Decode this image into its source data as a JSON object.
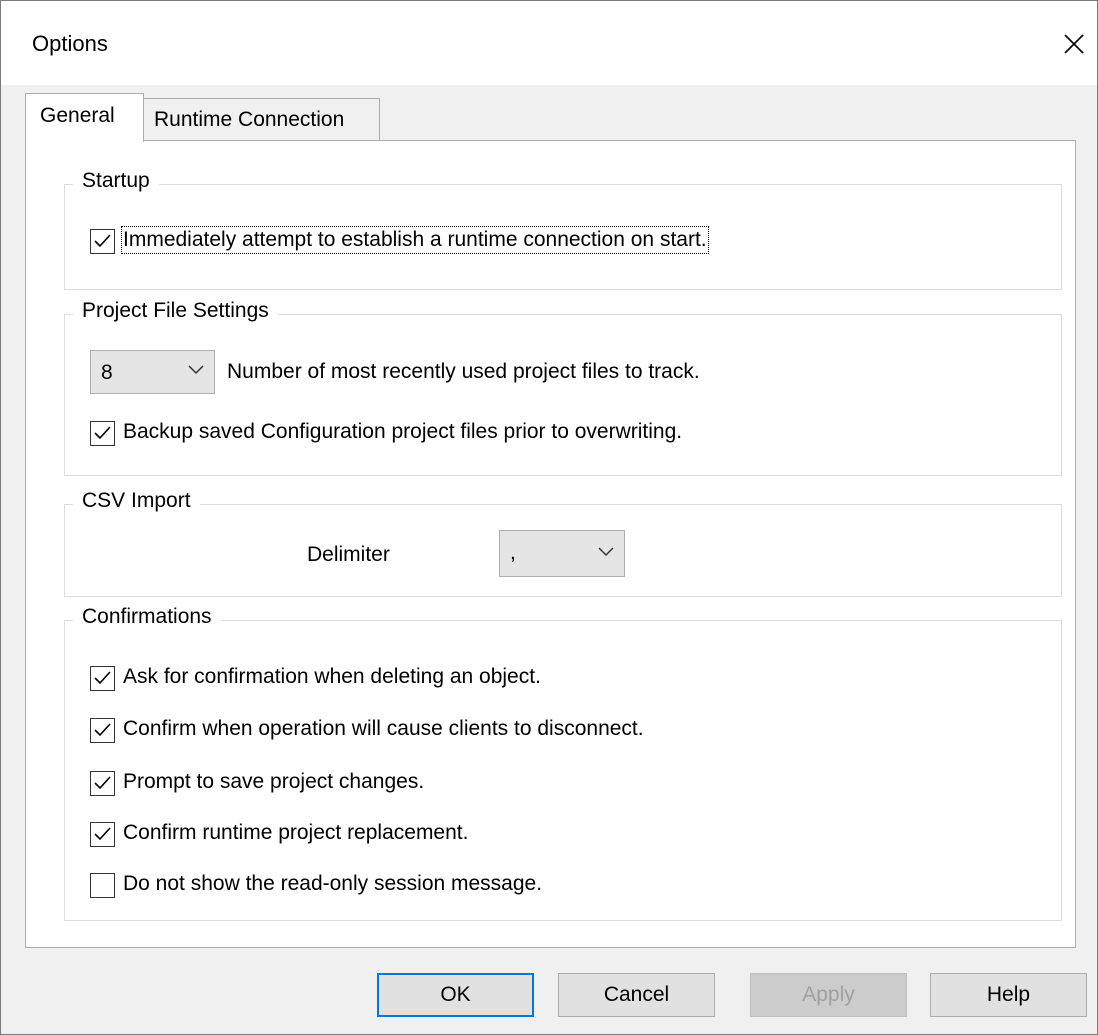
{
  "window": {
    "title": "Options"
  },
  "tabs": [
    {
      "label": "General",
      "active": true
    },
    {
      "label": "Runtime Connection",
      "active": false
    }
  ],
  "startup": {
    "group_label": "Startup",
    "auto_connect": {
      "label": "Immediately attempt to establish a runtime connection on start.",
      "checked": true,
      "focused": true
    }
  },
  "project_file_settings": {
    "group_label": "Project File Settings",
    "mru_count": {
      "value": "8",
      "label": "Number of most recently used project files to track."
    },
    "backup": {
      "label": "Backup saved Configuration project files prior to overwriting.",
      "checked": true
    }
  },
  "csv_import": {
    "group_label": "CSV Import",
    "delimiter_label": "Delimiter",
    "delimiter_value": ","
  },
  "confirmations": {
    "group_label": "Confirmations",
    "items": [
      {
        "label": "Ask for confirmation when deleting an object.",
        "checked": true
      },
      {
        "label": "Confirm when operation will cause clients to disconnect.",
        "checked": true
      },
      {
        "label": "Prompt to save project changes.",
        "checked": true
      },
      {
        "label": "Confirm runtime project replacement.",
        "checked": true
      },
      {
        "label": "Do not show the read-only session message.",
        "checked": false
      }
    ]
  },
  "buttons": {
    "ok": "OK",
    "cancel": "Cancel",
    "apply": "Apply",
    "help": "Help"
  },
  "colors": {
    "default_button_border": "#0078d7",
    "window_bg": "#f0f0f0",
    "panel_bg": "#ffffff"
  }
}
